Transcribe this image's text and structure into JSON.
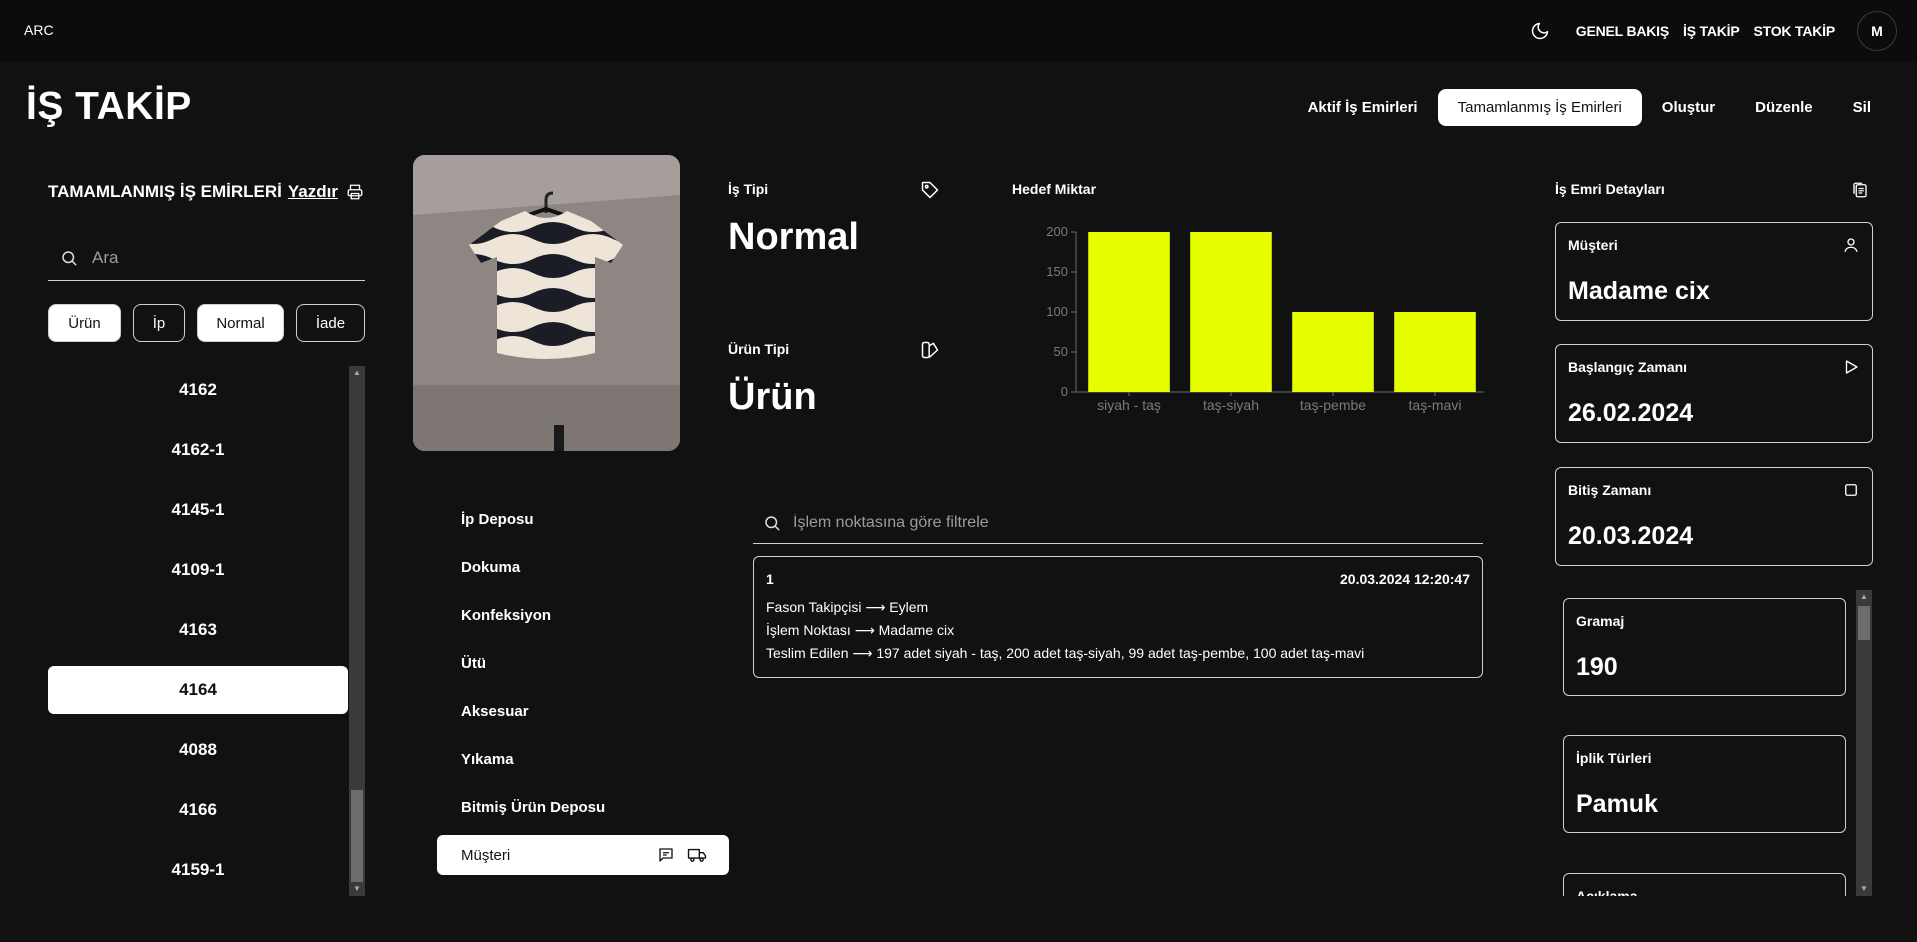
{
  "nav": {
    "logo": "ARC",
    "links": [
      "GENEL BAKIŞ",
      "İŞ TAKİP",
      "STOK TAKİP"
    ],
    "avatar_initial": "M",
    "theme_icon": "moon-icon"
  },
  "header": {
    "title": "İŞ TAKİP",
    "tabs": [
      "Aktif İş Emirleri",
      "Tamamlanmış İş Emirleri",
      "Oluştur",
      "Düzenle",
      "Sil"
    ],
    "active_tab": "Tamamlanmış İş Emirleri"
  },
  "left": {
    "heading": "TAMAMLANMIŞ İŞ EMİRLERİ",
    "print_label": "Yazdır",
    "search_placeholder": "Ara",
    "filters": [
      "Ürün",
      "İp",
      "Normal",
      "İade"
    ],
    "active_filters": [
      "Ürün",
      "Normal"
    ],
    "orders": [
      "4162",
      "4162-1",
      "4145-1",
      "4109-1",
      "4163",
      "4164",
      "4088",
      "4166",
      "4159-1"
    ],
    "selected_order": "4164"
  },
  "info": {
    "job_type_label": "İş Tipi",
    "job_type_value": "Normal",
    "product_type_label": "Ürün Tipi",
    "product_type_value": "Ürün"
  },
  "chart_data": {
    "type": "bar",
    "title": "Hedef Miktar",
    "categories": [
      "siyah - taş",
      "taş-siyah",
      "taş-pembe",
      "taş-mavi"
    ],
    "values": [
      200,
      200,
      100,
      100
    ],
    "ylim": [
      0,
      200
    ],
    "yticks": [
      0,
      50,
      100,
      150,
      200
    ],
    "bar_color": "#e6ff00",
    "axis_color": "#6b6b6b",
    "grid": false
  },
  "steps": {
    "items": [
      "İp Deposu",
      "Dokuma",
      "Konfeksiyon",
      "Ütü",
      "Aksesuar",
      "Yıkama",
      "Bitmiş Ürün Deposu"
    ],
    "active": "Müşteri"
  },
  "log": {
    "search_placeholder": "İşlem noktasına göre filtrele",
    "entry": {
      "index": "1",
      "timestamp": "20.03.2024 12:20:47",
      "line1": "Fason Takipçisi ⟶ Eylem",
      "line2": "İşlem Noktası ⟶ Madame cix",
      "line3": "Teslim Edilen ⟶ 197 adet siyah - taş, 200 adet taş-siyah, 99 adet taş-pembe, 100 adet taş-mavi"
    }
  },
  "details": {
    "heading": "İş Emri Detayları",
    "customer_label": "Müşteri",
    "customer_value": "Madame cix",
    "start_label": "Başlangıç Zamanı",
    "start_value": "26.02.2024",
    "end_label": "Bitiş Zamanı",
    "end_value": "20.03.2024",
    "gramaj_label": "Gramaj",
    "gramaj_value": "190",
    "yarn_label": "İplik Türleri",
    "yarn_value": "Pamuk",
    "desc_label": "Açıklama"
  }
}
